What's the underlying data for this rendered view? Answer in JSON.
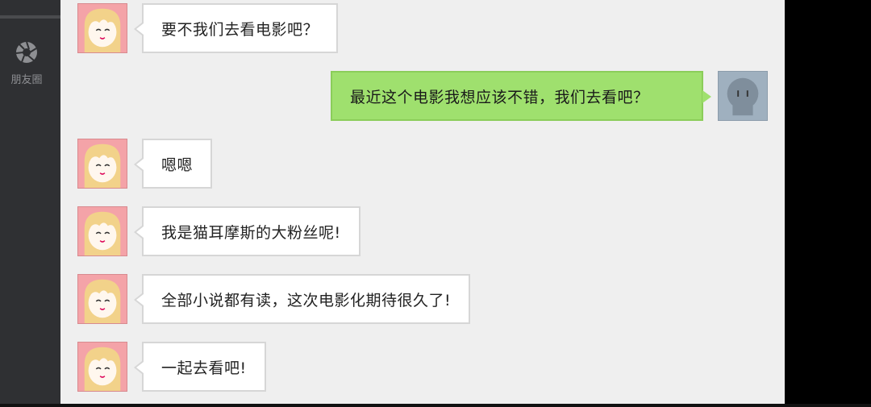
{
  "sidebar": {
    "moments_label": "朋友圈",
    "moments_icon": "camera-aperture-icon"
  },
  "messages": [
    {
      "sender": "girl",
      "text": "要不我们去看电影吧？"
    },
    {
      "sender": "me",
      "text": "最近这个电影我想应该不错，我们去看吧？"
    },
    {
      "sender": "girl",
      "text": "嗯嗯"
    },
    {
      "sender": "girl",
      "text": "我是猫耳摩斯的大粉丝呢!"
    },
    {
      "sender": "girl",
      "text": "全部小说都有读，这次电影化期待很久了!"
    },
    {
      "sender": "girl",
      "text": "一起去看吧!"
    }
  ],
  "colors": {
    "chat_background": "#efefef",
    "sent_bubble": "#9fe06e",
    "received_bubble": "#ffffff",
    "sidebar": "#2f3033"
  }
}
